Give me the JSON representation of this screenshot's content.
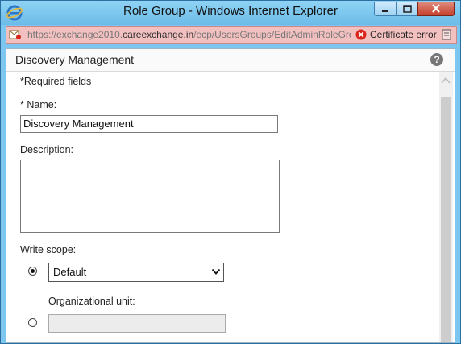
{
  "window": {
    "title": "Role Group - Windows Internet Explorer",
    "minimize_icon": "minimize-icon",
    "maximize_icon": "maximize-icon",
    "close_icon": "close-icon"
  },
  "addressbar": {
    "url_prefix": "https://exchange2010.",
    "url_domain": "careexchange.in",
    "url_path": "/ecp/UsersGroups/EditAdminRoleGro",
    "certificate_text": "Certificate error",
    "colors": {
      "background": "#f3c0c0",
      "error": "#d9251c"
    }
  },
  "page": {
    "title": "Discovery Management",
    "help_glyph": "?",
    "required_note": "*Required fields"
  },
  "form": {
    "name_label": "* Name:",
    "name_value": "Discovery Management",
    "description_label": "Description:",
    "description_value": "",
    "write_scope_label": "Write scope:",
    "write_scope_selected": "Default",
    "default_radio_checked": true,
    "org_unit_label": "Organizational unit:",
    "org_unit_value": "",
    "org_unit_radio_checked": false
  },
  "colors": {
    "window_frame": "#7cc6ef",
    "scroll_thumb": "#cdcdcd"
  }
}
